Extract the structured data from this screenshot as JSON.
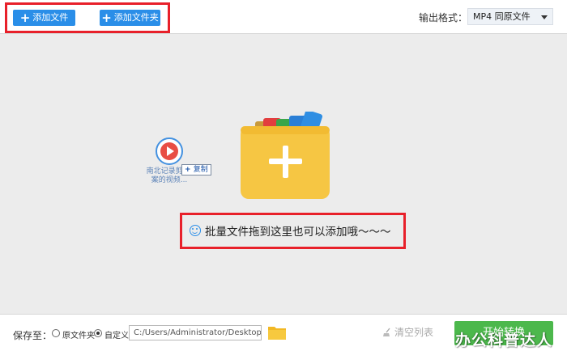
{
  "toolbar": {
    "add_file_label": "添加文件",
    "add_folder_label": "添加文件夹",
    "output_format_label": "输出格式：",
    "output_format_value": "MP4  同原文件"
  },
  "drop_area": {
    "hint": "批量文件拖到这里也可以添加哦～～～",
    "dragging_file_name": "南北记录剪 文案的视频...",
    "copy_badge_label": "复制"
  },
  "bottom": {
    "save_to_label": "保存至：",
    "option_original_folder": "原文件夹",
    "option_custom": "自定义",
    "path_value": "C:/Users/Administrator/Desktop",
    "clear_list_label": "清空列表",
    "start_convert_label": "开始转换"
  },
  "watermark": "办公科普达人",
  "colors": {
    "accent_blue": "#2a8ee8",
    "highlight_red": "#e8202a",
    "start_green": "#4cb84c",
    "folder_yellow": "#f6c643"
  }
}
